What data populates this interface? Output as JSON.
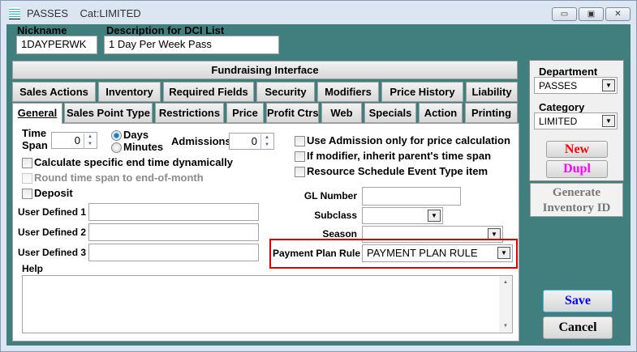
{
  "window": {
    "title": "PASSES",
    "category": "Cat:LIMITED",
    "controls": [
      "minimize",
      "maximize",
      "close"
    ]
  },
  "header": {
    "nickname_label": "Nickname",
    "nickname_value": "1DAYPERWK",
    "description_label": "Description for DCI List",
    "description_value": "1 Day Per Week Pass"
  },
  "fundraising_label": "Fundraising Interface",
  "tabs_row1": [
    "Sales Actions",
    "Inventory",
    "Required Fields",
    "Security",
    "Modifiers",
    "Price History",
    "Liability"
  ],
  "tabs_row2": [
    "General",
    "Sales Point Type",
    "Restrictions",
    "Price",
    "Profit Ctrs",
    "Web",
    "Specials",
    "Action",
    "Printing"
  ],
  "active_tab": "General",
  "general": {
    "time_span_label1": "Time",
    "time_span_label2": "Span",
    "time_span_value": "0",
    "days_label": "Days",
    "minutes_label": "Minutes",
    "unit_selected": "Days",
    "admissions_label": "Admissions",
    "admissions_value": "0",
    "calc_end_time": "Calculate specific end time dynamically",
    "round_time_span": "Round time span to end-of-month",
    "deposit": "Deposit",
    "user_defined": [
      {
        "label": "User Defined 1",
        "value": ""
      },
      {
        "label": "User Defined 2",
        "value": ""
      },
      {
        "label": "User Defined 3",
        "value": ""
      }
    ],
    "help_label": "Help",
    "use_admission": "Use Admission only for price calculation",
    "inherit_time_span": "If modifier, inherit parent's time span",
    "resource_schedule": "Resource Schedule Event Type item",
    "gl_number_label": "GL Number",
    "gl_number_value": "",
    "subclass_label": "Subclass",
    "subclass_value": "",
    "season_label": "Season",
    "season_value": "",
    "payment_plan_label": "Payment Plan Rule",
    "payment_plan_value": "PAYMENT PLAN RULE"
  },
  "sidebar": {
    "department_label": "Department",
    "department_value": "PASSES",
    "category_label": "Category",
    "category_value": "LIMITED",
    "new_label": "New",
    "dupl_label": "Dupl",
    "generate_line1": "Generate",
    "generate_line2": "Inventory ID"
  },
  "footer": {
    "save_label": "Save",
    "cancel_label": "Cancel"
  },
  "colors": {
    "background": "#417f7f",
    "highlight": "#e00000",
    "new": "#ff0000",
    "dupl": "#ff00ff",
    "save": "#0000ff"
  }
}
